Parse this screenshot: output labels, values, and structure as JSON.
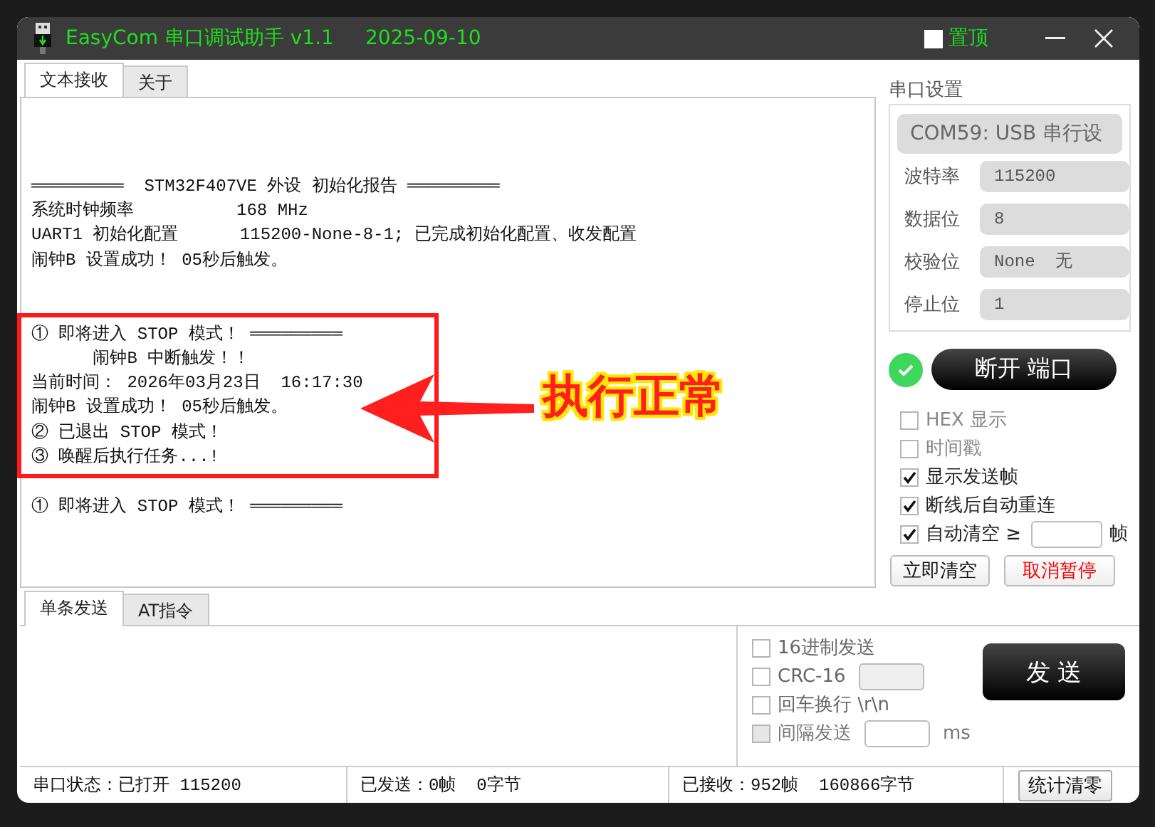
{
  "window": {
    "title": "EasyCom 串口调试助手 v1.1",
    "date": "2025-09-10",
    "pin_on_top": {
      "label": "置顶",
      "checked": false
    }
  },
  "receive_tabs": [
    {
      "label": "文本接收",
      "selected": true
    },
    {
      "label": "关于",
      "selected": false
    }
  ],
  "receive_log": [
    {
      "kind": "plain",
      "lines": [
        "═════════  STM32F407VE 外设 初始化报告 ═════════",
        "系统时钟频率          168 MHz",
        "UART1 初始化配置      115200-None-8-1; 已完成初始化配置、收发配置",
        "闹钟B 设置成功！ 05秒后触发。"
      ]
    },
    {
      "kind": "highlighted",
      "lines": [
        "① 即将进入 STOP 模式！ ═════════",
        "      闹钟B 中断触发！！",
        "当前时间： 2026年03月23日  16:17:30",
        "闹钟B 设置成功！ 05秒后触发。",
        "② 已退出 STOP 模式！",
        "③ 唤醒后执行任务...!"
      ]
    },
    {
      "kind": "plain",
      "lines": [
        "① 即将进入 STOP 模式！ ═════════"
      ]
    }
  ],
  "annotation": {
    "text": "执行正常"
  },
  "serial_settings": {
    "title": "串口设置",
    "port": "COM59: USB 串行设",
    "fields": [
      {
        "label": "波特率",
        "value": "115200"
      },
      {
        "label": "数据位",
        "value": "8"
      },
      {
        "label": "校验位",
        "value": "None  无"
      },
      {
        "label": "停止位",
        "value": "1"
      }
    ],
    "connected": true,
    "toggle_button": "断开 端口",
    "options": [
      {
        "kind": "plain",
        "label": "HEX 显示",
        "checked": false
      },
      {
        "kind": "plain",
        "label": "时间戳",
        "checked": false
      },
      {
        "kind": "plain",
        "label": "显示发送帧",
        "checked": true
      },
      {
        "kind": "plain",
        "label": "断线后自动重连",
        "checked": true
      },
      {
        "kind": "input",
        "label": "自动清空 ≥",
        "checked": true,
        "unit": "帧"
      }
    ],
    "buttons": [
      {
        "kind": "normal",
        "label": "立即清空"
      },
      {
        "kind": "warning",
        "label": "取消暂停"
      }
    ]
  },
  "send_tabs": [
    {
      "label": "单条发送",
      "selected": true
    },
    {
      "label": "AT指令",
      "selected": false
    }
  ],
  "send_options": [
    {
      "kind": "plain",
      "label": "16进制发送",
      "checked": false,
      "disabled": false
    },
    {
      "kind": "input",
      "label": "CRC-16",
      "checked": false,
      "disabled": false
    },
    {
      "kind": "plain",
      "label": "回车换行 \\r\\n",
      "checked": false,
      "disabled": false
    },
    {
      "kind": "input",
      "label": "间隔发送",
      "checked": false,
      "disabled": true,
      "unit": "ms"
    }
  ],
  "send_button": "发 送",
  "status_bar": {
    "port_status": "串口状态：已打开 115200",
    "sent": "已发送：0帧  0字节",
    "received": "已接收：952帧  160866字节",
    "reset_button": "统计清零"
  }
}
